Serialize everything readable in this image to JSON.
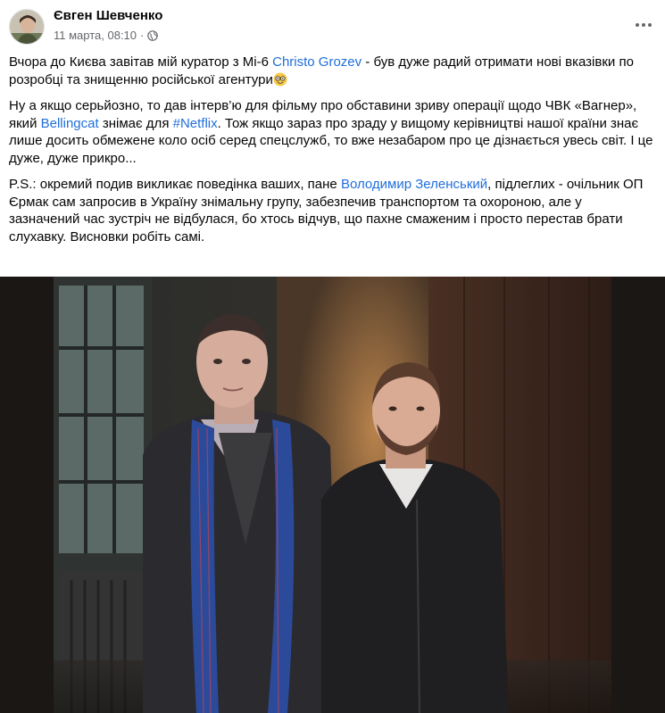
{
  "post": {
    "author": "Євген Шевченко",
    "timestamp": "11 марта, 08:10",
    "separator": "·",
    "privacy_icon": "globe-icon",
    "more_icon": "more-horizontal-icon",
    "paragraphs": [
      {
        "parts": [
          {
            "text": "Вчора до Києва завітав мій куратор з Мі-6 "
          },
          {
            "link": "Christo Grozev"
          },
          {
            "text": " - був дуже радий отримати нові вказівки по розробці та знищенню російської агентури"
          },
          {
            "emoji": "nerd-face-emoji"
          }
        ]
      },
      {
        "parts": [
          {
            "text": "Ну а якщо серьйозно, то дав інтерв’ю для фільму про обставини зриву операції щодо ЧВК «Вагнер», який "
          },
          {
            "link": "Bellingcat"
          },
          {
            "text": " знімає для "
          },
          {
            "link": "#Netflix"
          },
          {
            "text": ". Тож якщо зараз про зраду у вищому керівництві нашої країни знає лише досить обмежене коло осіб серед спецслужб, то вже незабаром про це дізнається увесь світ. І це дуже, дуже прикро..."
          }
        ]
      },
      {
        "parts": [
          {
            "text": "P.S.: окремий подив викликає поведінка ваших, пане "
          },
          {
            "link": "Володимир Зеленський"
          },
          {
            "text": ", підлеглих - очільник ОП Єрмак сам запросив в Україну знімальну групу, забезпечив транспортом та охороною, але у зазначений час зустріч не відбулася, бо хтось відчув, що пахне смаженим і просто перестав брати слухавку. Висновки робіть самі."
          }
        ]
      }
    ],
    "colors": {
      "link": "#216fdb",
      "text": "#050505",
      "secondary": "#65676b"
    }
  }
}
